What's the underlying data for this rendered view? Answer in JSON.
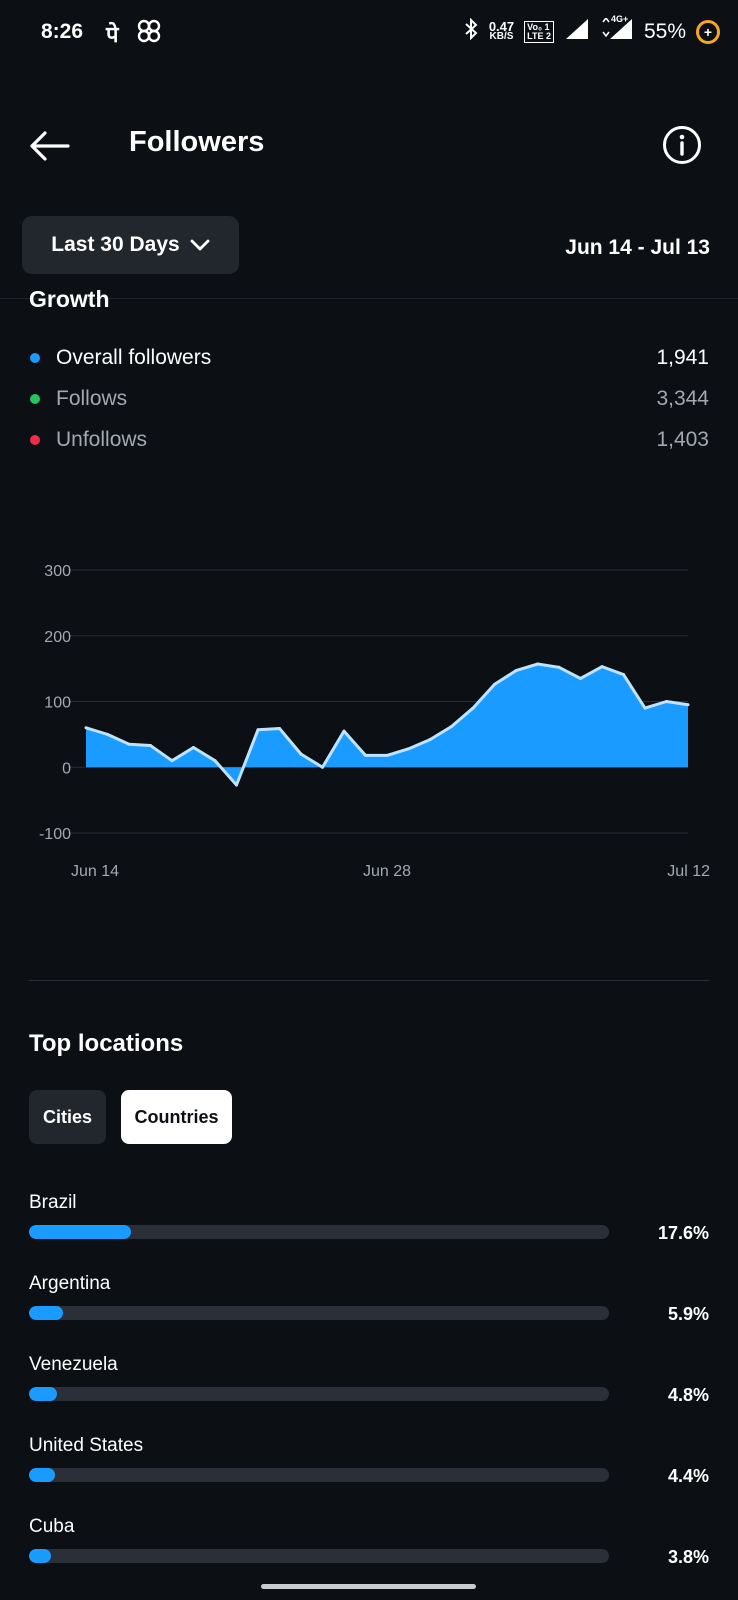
{
  "status_bar": {
    "time": "8:26",
    "pe_icon": "पे",
    "net_speed_value": "0.47",
    "net_speed_unit": "KB/S",
    "volte_top": "Vo₀ 1",
    "volte_bottom": "LTE 2",
    "network_label": "4G+",
    "battery": "55%"
  },
  "header": {
    "title": "Followers",
    "back_icon": "arrow-left-icon",
    "info_icon": "info-icon"
  },
  "filter": {
    "range_label": "Last 30 Days",
    "date_range": "Jun 14 - Jul 13"
  },
  "growth": {
    "title": "Growth",
    "stats": [
      {
        "label": "Overall followers",
        "value": "1,941",
        "color": "#1a9bff"
      },
      {
        "label": "Follows",
        "value": "3,344",
        "color": "#22c55e"
      },
      {
        "label": "Unfollows",
        "value": "1,403",
        "color": "#ef2d4b"
      }
    ]
  },
  "chart_data": {
    "type": "area",
    "x": [
      "Jun 14",
      "Jun 15",
      "Jun 16",
      "Jun 17",
      "Jun 18",
      "Jun 19",
      "Jun 20",
      "Jun 21",
      "Jun 22",
      "Jun 23",
      "Jun 24",
      "Jun 25",
      "Jun 26",
      "Jun 27",
      "Jun 28",
      "Jun 29",
      "Jun 30",
      "Jul 1",
      "Jul 2",
      "Jul 3",
      "Jul 4",
      "Jul 5",
      "Jul 6",
      "Jul 7",
      "Jul 8",
      "Jul 9",
      "Jul 10",
      "Jul 11",
      "Jul 12"
    ],
    "xticks": [
      "Jun 14",
      "Jun 28",
      "Jul 12"
    ],
    "yticks": [
      "300",
      "200",
      "100",
      "0",
      "-100"
    ],
    "ylim": [
      -100,
      300
    ],
    "series": [
      {
        "values": [
          60,
          50,
          35,
          33,
          10,
          30,
          10,
          -27,
          57,
          59,
          20,
          0,
          55,
          18,
          18,
          28,
          42,
          62,
          90,
          126,
          147,
          157,
          152,
          135,
          153,
          141,
          90,
          100,
          95
        ],
        "color": "#1a9bff"
      }
    ],
    "grid": true
  },
  "locations": {
    "title": "Top locations",
    "tabs": [
      "Cities",
      "Countries"
    ],
    "selected_tab": "Countries",
    "items": [
      {
        "name": "Brazil",
        "percent": "17.6%",
        "fraction": 0.176
      },
      {
        "name": "Argentina",
        "percent": "5.9%",
        "fraction": 0.059
      },
      {
        "name": "Venezuela",
        "percent": "4.8%",
        "fraction": 0.048
      },
      {
        "name": "United States",
        "percent": "4.4%",
        "fraction": 0.044
      },
      {
        "name": "Cuba",
        "percent": "3.8%",
        "fraction": 0.038
      }
    ]
  }
}
